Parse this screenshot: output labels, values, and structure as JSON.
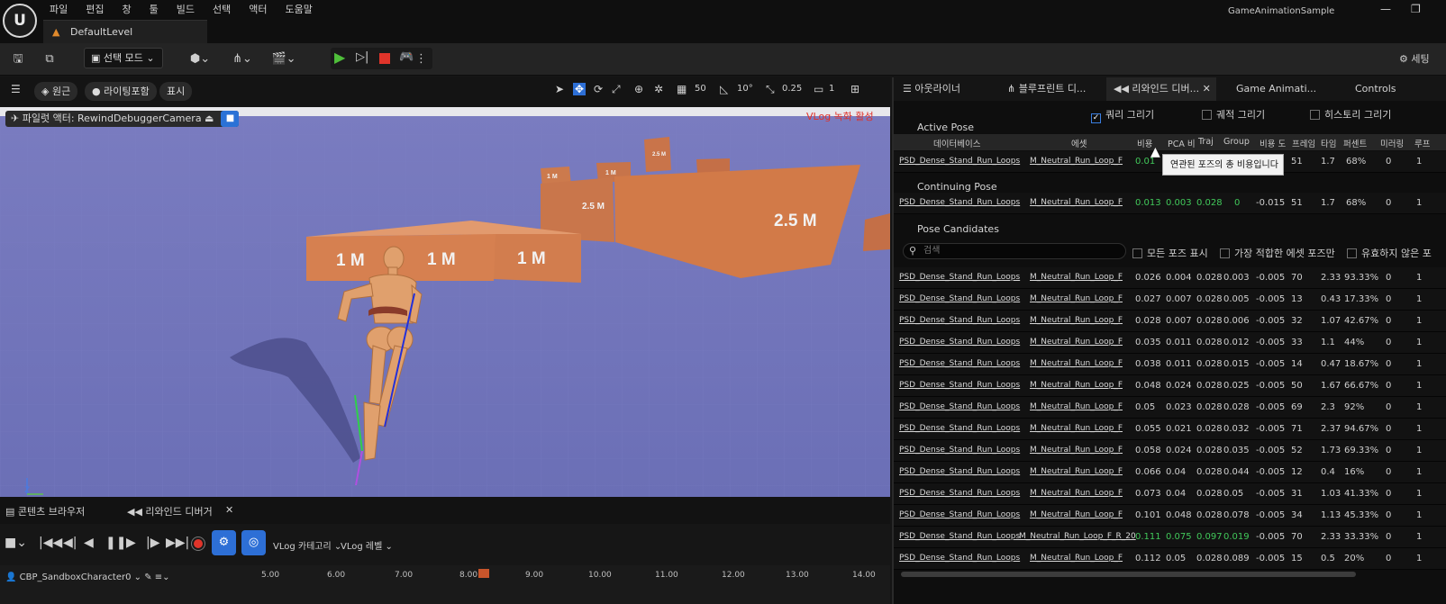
{
  "window": {
    "app_name": "GameAnimationSample",
    "logo_text": "U",
    "level_tab": "DefaultLevel",
    "menu": [
      "파일",
      "편집",
      "창",
      "툴",
      "빌드",
      "선택",
      "액터",
      "도움말"
    ]
  },
  "toolbar": {
    "mode_label": "선택 모드",
    "settings_label": "세팅"
  },
  "viewport": {
    "perspective": "원근",
    "lighting": "라이팅포함",
    "show": "표시",
    "grid_snap": "50",
    "rotation_snap": "10°",
    "scale_snap": "0.25",
    "camera_speed": "1",
    "pilot_label": "파일럿 액터: RewindDebuggerCamera",
    "vlog_title": "VLog 녹화 활성",
    "axis_z": "Z",
    "axis_y": "Y",
    "wall_labels": [
      "1 M",
      "1 M",
      "1 M",
      "2.5 M",
      "2.5 M",
      "1 M",
      "1 M",
      "2.5 M"
    ]
  },
  "bottom": {
    "tab_content": "콘텐츠 브라우저",
    "tab_rewind": "리와인드 디버거",
    "vlog_category": "VLog 카테고리",
    "vlog_level": "VLog 레벨",
    "target": "CBP_SandboxCharacter0",
    "timeline_ticks": [
      "5.00",
      "6.00",
      "7.00",
      "8.00",
      "9.00",
      "10.00",
      "11.00",
      "12.00",
      "13.00",
      "14.00"
    ]
  },
  "right_panel": {
    "tabs": [
      "아웃라이너",
      "블루프린트 디...",
      "리와인드 디버...",
      "Game Animati...",
      "Controls"
    ],
    "options": {
      "draw_query": "쿼리 그리기",
      "draw_trajectory": "궤적 그리기",
      "draw_history": "히스토리 그리기"
    },
    "sections": {
      "active": "Active Pose",
      "continuing": "Continuing Pose",
      "candidates": "Pose Candidates"
    },
    "columns": [
      "데이터베이스",
      "에셋",
      "비용",
      "PCA 비",
      "Traj",
      "Group",
      "비용 도",
      "프레임",
      "타임",
      "퍼센트",
      "미러링",
      "루프"
    ],
    "tooltip": "연관된 포즈의 총 비용입니다",
    "search_placeholder": "검색",
    "filters": {
      "show_all": "모든 포즈 표시",
      "best_asset": "가장 적합한 에셋 포즈만",
      "show_invalid": "유효하지 않은 포"
    },
    "active_row": {
      "db": "PSD_Dense_Stand_Run_Loops",
      "asset": "M_Neutral_Run_Loop_F",
      "cost": "0.01",
      "frame": "5",
      "frame2": "51",
      "time": "1.7",
      "pct": "68%",
      "mirror": "0",
      "loop": "1"
    },
    "continuing_row": {
      "db": "PSD_Dense_Stand_Run_Loops",
      "asset": "M_Neutral_Run_Loop_F",
      "cost": "0.013",
      "pca": "0.003",
      "traj": "0.028",
      "group": "0",
      "delta": "-0.015",
      "frame": "51",
      "time": "1.7",
      "pct": "68%",
      "mirror": "0",
      "loop": "1"
    },
    "candidates": [
      {
        "db": "PSD_Dense_Stand_Run_Loops",
        "asset": "M_Neutral_Run_Loop_F",
        "cost": "0.026",
        "pca": "0.004",
        "traj": "0.028",
        "group": "0.003",
        "delta": "-0.005",
        "frame": "70",
        "time": "2.33",
        "pct": "93.33%",
        "mirror": "0",
        "loop": "1",
        "green": false
      },
      {
        "db": "PSD_Dense_Stand_Run_Loops",
        "asset": "M_Neutral_Run_Loop_F",
        "cost": "0.027",
        "pca": "0.007",
        "traj": "0.028",
        "group": "0.005",
        "delta": "-0.005",
        "frame": "13",
        "time": "0.43",
        "pct": "17.33%",
        "mirror": "0",
        "loop": "1",
        "green": false
      },
      {
        "db": "PSD_Dense_Stand_Run_Loops",
        "asset": "M_Neutral_Run_Loop_F",
        "cost": "0.028",
        "pca": "0.007",
        "traj": "0.028",
        "group": "0.006",
        "delta": "-0.005",
        "frame": "32",
        "time": "1.07",
        "pct": "42.67%",
        "mirror": "0",
        "loop": "1",
        "green": false
      },
      {
        "db": "PSD_Dense_Stand_Run_Loops",
        "asset": "M_Neutral_Run_Loop_F",
        "cost": "0.035",
        "pca": "0.011",
        "traj": "0.028",
        "group": "0.012",
        "delta": "-0.005",
        "frame": "33",
        "time": "1.1",
        "pct": "44%",
        "mirror": "0",
        "loop": "1",
        "green": false
      },
      {
        "db": "PSD_Dense_Stand_Run_Loops",
        "asset": "M_Neutral_Run_Loop_F",
        "cost": "0.038",
        "pca": "0.011",
        "traj": "0.028",
        "group": "0.015",
        "delta": "-0.005",
        "frame": "14",
        "time": "0.47",
        "pct": "18.67%",
        "mirror": "0",
        "loop": "1",
        "green": false
      },
      {
        "db": "PSD_Dense_Stand_Run_Loops",
        "asset": "M_Neutral_Run_Loop_F",
        "cost": "0.048",
        "pca": "0.024",
        "traj": "0.028",
        "group": "0.025",
        "delta": "-0.005",
        "frame": "50",
        "time": "1.67",
        "pct": "66.67%",
        "mirror": "0",
        "loop": "1",
        "green": false
      },
      {
        "db": "PSD_Dense_Stand_Run_Loops",
        "asset": "M_Neutral_Run_Loop_F",
        "cost": "0.05",
        "pca": "0.023",
        "traj": "0.028",
        "group": "0.028",
        "delta": "-0.005",
        "frame": "69",
        "time": "2.3",
        "pct": "92%",
        "mirror": "0",
        "loop": "1",
        "green": false
      },
      {
        "db": "PSD_Dense_Stand_Run_Loops",
        "asset": "M_Neutral_Run_Loop_F",
        "cost": "0.055",
        "pca": "0.021",
        "traj": "0.028",
        "group": "0.032",
        "delta": "-0.005",
        "frame": "71",
        "time": "2.37",
        "pct": "94.67%",
        "mirror": "0",
        "loop": "1",
        "green": false
      },
      {
        "db": "PSD_Dense_Stand_Run_Loops",
        "asset": "M_Neutral_Run_Loop_F",
        "cost": "0.058",
        "pca": "0.024",
        "traj": "0.028",
        "group": "0.035",
        "delta": "-0.005",
        "frame": "52",
        "time": "1.73",
        "pct": "69.33%",
        "mirror": "0",
        "loop": "1",
        "green": false
      },
      {
        "db": "PSD_Dense_Stand_Run_Loops",
        "asset": "M_Neutral_Run_Loop_F",
        "cost": "0.066",
        "pca": "0.04",
        "traj": "0.028",
        "group": "0.044",
        "delta": "-0.005",
        "frame": "12",
        "time": "0.4",
        "pct": "16%",
        "mirror": "0",
        "loop": "1",
        "green": false
      },
      {
        "db": "PSD_Dense_Stand_Run_Loops",
        "asset": "M_Neutral_Run_Loop_F",
        "cost": "0.073",
        "pca": "0.04",
        "traj": "0.028",
        "group": "0.05",
        "delta": "-0.005",
        "frame": "31",
        "time": "1.03",
        "pct": "41.33%",
        "mirror": "0",
        "loop": "1",
        "green": false
      },
      {
        "db": "PSD_Dense_Stand_Run_Loops",
        "asset": "M_Neutral_Run_Loop_F",
        "cost": "0.101",
        "pca": "0.048",
        "traj": "0.028",
        "group": "0.078",
        "delta": "-0.005",
        "frame": "34",
        "time": "1.13",
        "pct": "45.33%",
        "mirror": "0",
        "loop": "1",
        "green": false
      },
      {
        "db": "PSD_Dense_Stand_Run_Loops",
        "asset": "M_Neutral_Run_Loop_F_R_20",
        "cost": "0.111",
        "pca": "0.075",
        "traj": "0.097",
        "group": "0.019",
        "delta": "-0.005",
        "frame": "70",
        "time": "2.33",
        "pct": "33.33%",
        "mirror": "0",
        "loop": "1",
        "green": true
      },
      {
        "db": "PSD_Dense_Stand_Run_Loops",
        "asset": "M_Neutral_Run_Loop_F",
        "cost": "0.112",
        "pca": "0.05",
        "traj": "0.028",
        "group": "0.089",
        "delta": "-0.005",
        "frame": "15",
        "time": "0.5",
        "pct": "20%",
        "mirror": "0",
        "loop": "1",
        "green": false
      }
    ]
  },
  "colors": {
    "accent_blue": "#2d6fd6",
    "play_green": "#4fbf3a",
    "record_red": "#e0342a",
    "cost_green": "#41c85a",
    "wall_orange": "#d27a48",
    "floor_purple": "#6a6fb8"
  }
}
